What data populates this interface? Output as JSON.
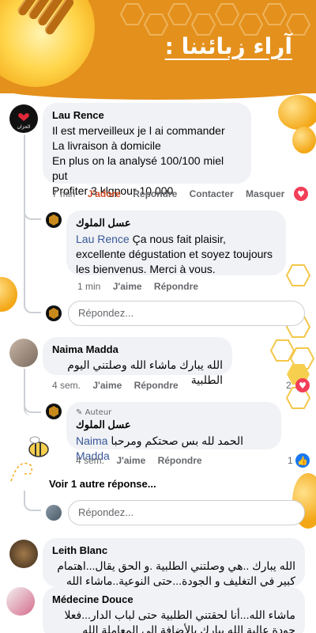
{
  "banner": {
    "title": "آراء زبائننا :"
  },
  "comments": [
    {
      "name": "Lau Rence",
      "lines": [
        "Il est merveilleux je l ai commander",
        "La livraison à domicile",
        "En plus on la analysé 100/100 miel put",
        "Profiter 3 klgpour 10 000"
      ],
      "time": "7 min",
      "reaction_label": "J'adore",
      "reply_label": "Répondre",
      "contact_label": "Contacter",
      "hide_label": "Masquer"
    },
    {
      "name": "عسل الملوك",
      "mention": "Lau Rence",
      "text": " Ça nous fait plaisir, excellente dégustation et soyez toujours les bienvenus. Merci à vous.",
      "time": "1 min",
      "like_label": "J'aime",
      "reply_label": "Répondre"
    },
    {
      "name": "Naima Madda",
      "text": "الله يبارك ماشاء الله وصلتني اليوم الطلبية",
      "time": "4 sem.",
      "like_label": "J'aime",
      "reply_label": "Répondre",
      "reactions_count": "2"
    },
    {
      "author_tag": "Auteur",
      "name": "عسل الملوك",
      "text": "الحمد لله بس صحتكم ومرحبا ",
      "mention": "Naima Madda",
      "time": "4 sem.",
      "like_label": "J'aime",
      "reply_label": "Répondre",
      "reactions_count": "1"
    },
    {
      "name": "Leith Blanc",
      "text": "الله يبارك ..هي وصلتني الطلبية .و الحق يقال...اهتمام كبير في التغليف و الجودة...حتى النوعية..ماشاء الله"
    },
    {
      "name": "Médecine Douce",
      "text": "ماشاء الله...أنا لحقتني الطلبية حتى لباب الدار...فعلا جودة عالية الله يبارك بالأضافة إلى المعاملة الله يبارك..شكرا"
    }
  ],
  "reply_placeholder": "Répondez...",
  "more_replies": "Voir 1 autre réponse...",
  "colors": {
    "accent": "#e4901c",
    "link": "#385898",
    "love": "#f33e58",
    "like": "#1877f2"
  }
}
